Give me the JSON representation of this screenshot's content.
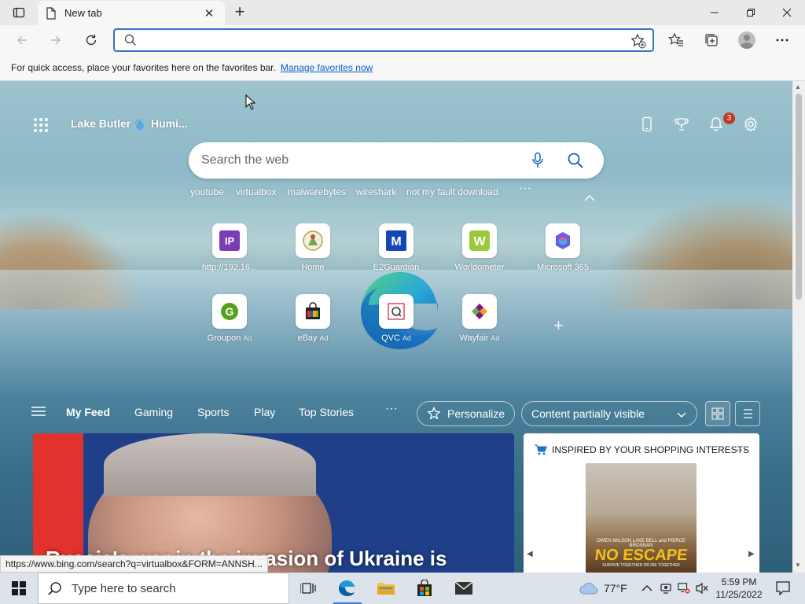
{
  "browser": {
    "tab_title": "New tab",
    "address_value": "",
    "favorites_bar": {
      "message": "For quick access, place your favorites here on the favorites bar.",
      "link": "Manage favorites now"
    }
  },
  "newtab": {
    "location": "Lake Butler",
    "weather": "Humi...",
    "notifications_count": "3",
    "search_placeholder": "Search the web",
    "trending": [
      "youtube",
      "virtualbox",
      "malwarebytes",
      "wireshark",
      "not my fault download"
    ],
    "quick_links_row1": [
      {
        "label": "http://192.16...",
        "ad": "",
        "icon": "ip-icon"
      },
      {
        "label": "Home",
        "ad": "",
        "icon": "home-site-icon"
      },
      {
        "label": "E2Guardian",
        "ad": "",
        "icon": "e2guardian-icon"
      },
      {
        "label": "Worldometer",
        "ad": "",
        "icon": "worldometer-icon"
      },
      {
        "label": "Microsoft 365",
        "ad": "",
        "icon": "microsoft-365-icon"
      }
    ],
    "quick_links_row2": [
      {
        "label": "Groupon",
        "ad": "Ad",
        "icon": "groupon-icon"
      },
      {
        "label": "eBay",
        "ad": "Ad",
        "icon": "ebay-icon"
      },
      {
        "label": "QVC",
        "ad": "Ad",
        "icon": "qvc-icon"
      },
      {
        "label": "Wayfair",
        "ad": "Ad",
        "icon": "wayfair-icon"
      }
    ],
    "feed_tabs": [
      "My Feed",
      "Gaming",
      "Sports",
      "Play",
      "Top Stories"
    ],
    "personalize": "Personalize",
    "visibility": "Content partially visible",
    "hero_headline": "Russia's war in the invasion of Ukraine is",
    "shopping": {
      "heading": "INSPIRED BY YOUR SHOPPING INTERESTS",
      "poster_credits": "OWEN WILSON  LAKE BELL  and PIERCE BROSNAN",
      "poster_title": "NO ESCAPE",
      "poster_tagline": "SURVIVE TOGETHER OR DIE TOGETHER"
    }
  },
  "status_url": "https://www.bing.com/search?q=virtualbox&FORM=ANNSH...",
  "taskbar": {
    "search_placeholder": "Type here to search",
    "temperature": "77°F",
    "time": "5:59 PM",
    "date": "11/25/2022"
  },
  "colors": {
    "accent": "#3a72c4",
    "link": "#0a60c8",
    "badge": "#c4391d"
  }
}
